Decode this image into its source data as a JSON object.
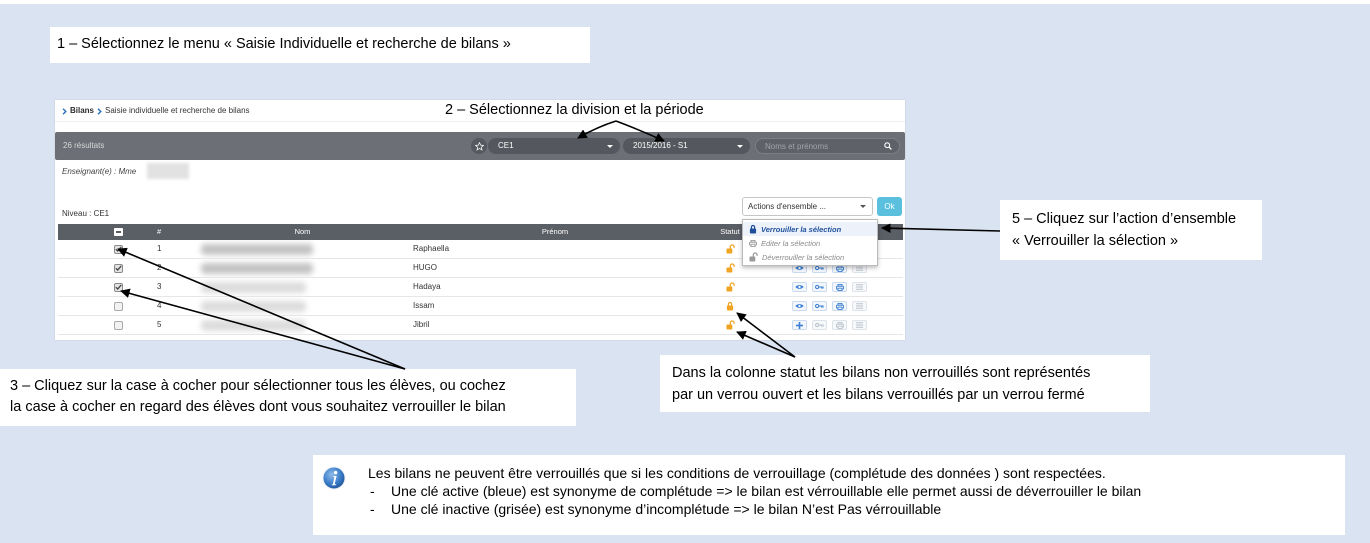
{
  "theme": {
    "background": "#dae3f2",
    "toolbar": "#6c6f76",
    "ok_button": "#5bc0de",
    "lock": "#f0a422",
    "action_active": "#3a7fd5",
    "action_inactive": "#b9c2cc"
  },
  "callouts": {
    "step1": "1 – Sélectionnez le menu « Saisie Individuelle et recherche de bilans »",
    "step2": "2 – Sélectionnez la division et la période",
    "step3": [
      "3 – Cliquez sur la case à cocher pour sélectionner tous les élèves, ou cochez",
      "la case à cocher en regard des élèves dont vous souhaitez verrouiller le bilan"
    ],
    "step5": [
      "5 – Cliquez sur l’action d’ensemble",
      "« Verrouiller la sélection »"
    ],
    "status": [
      "Dans la colonne statut les bilans non verrouillés sont représentés",
      "par un verrou ouvert et les bilans verrouillés par un verrou fermé"
    ]
  },
  "info": {
    "icon": "info-icon",
    "intro": "Les bilans ne peuvent être verrouillés que si les conditions de verrouillage (complétude des données ) sont respectées.",
    "bullet_marker": "-",
    "bullets": [
      "Une clé active (bleue) est synonyme de complétude => le bilan est vérrouillable elle permet aussi de déverrouiller le bilan",
      "Une clé inactive (grisée) est synonyme d’incomplétude => le bilan N’est Pas vérrouillable"
    ]
  },
  "app": {
    "breadcrumb": [
      "Bilans",
      "Saisie individuelle et recherche de bilans"
    ],
    "toolbar": {
      "results": "26 résultats",
      "division": "CE1",
      "period": "2015/2016 - S1",
      "search_placeholder": "Noms et prénoms"
    },
    "teacher_label": "Enseignant(e) : Mme",
    "level_label": "Niveau : CE1",
    "bulk_actions": {
      "selected": "Actions d'ensemble ...",
      "ok_label": "Ok",
      "menu": [
        {
          "label": "Verrouiller la sélection",
          "icon": "lock-closed-icon",
          "highlighted": true
        },
        {
          "label": "Editer la sélection",
          "icon": "print-icon",
          "highlighted": false
        },
        {
          "label": "Déverrouiller la sélection",
          "icon": "lock-open-icon",
          "highlighted": false
        }
      ]
    },
    "table": {
      "headers": {
        "number": "#",
        "nom": "Nom",
        "prenom": "Prénom",
        "statut": "Statut"
      },
      "rows": [
        {
          "number": "1",
          "prenom": "Raphaella",
          "checked": true,
          "status_icon": "lock-open-icon",
          "actions": [
            {
              "icon": "eye-icon",
              "active": true
            },
            {
              "icon": "key-icon",
              "active": true
            },
            {
              "icon": "print-icon",
              "active": true
            },
            {
              "icon": "list-icon",
              "active": false
            }
          ]
        },
        {
          "number": "2",
          "prenom": "HUGO",
          "checked": true,
          "status_icon": "lock-open-icon",
          "actions": [
            {
              "icon": "eye-icon",
              "active": true
            },
            {
              "icon": "key-icon",
              "active": true
            },
            {
              "icon": "print-icon",
              "active": true
            },
            {
              "icon": "list-icon",
              "active": false
            }
          ]
        },
        {
          "number": "3",
          "prenom": "Hadaya",
          "checked": true,
          "status_icon": "lock-open-icon",
          "actions": [
            {
              "icon": "eye-icon",
              "active": true
            },
            {
              "icon": "key-icon",
              "active": true
            },
            {
              "icon": "print-icon",
              "active": true
            },
            {
              "icon": "list-icon",
              "active": false
            }
          ]
        },
        {
          "number": "4",
          "prenom": "Issam",
          "checked": false,
          "status_icon": "lock-closed-icon",
          "actions": [
            {
              "icon": "eye-icon",
              "active": true
            },
            {
              "icon": "key-icon",
              "active": true
            },
            {
              "icon": "print-icon",
              "active": true
            },
            {
              "icon": "list-icon",
              "active": false
            }
          ]
        },
        {
          "number": "5",
          "prenom": "Jibril",
          "checked": false,
          "status_icon": "lock-open-icon",
          "actions": [
            {
              "icon": "plus-icon",
              "active": true
            },
            {
              "icon": "key-icon",
              "active": false
            },
            {
              "icon": "print-icon",
              "active": false
            },
            {
              "icon": "list-icon",
              "active": false
            }
          ]
        }
      ]
    }
  }
}
